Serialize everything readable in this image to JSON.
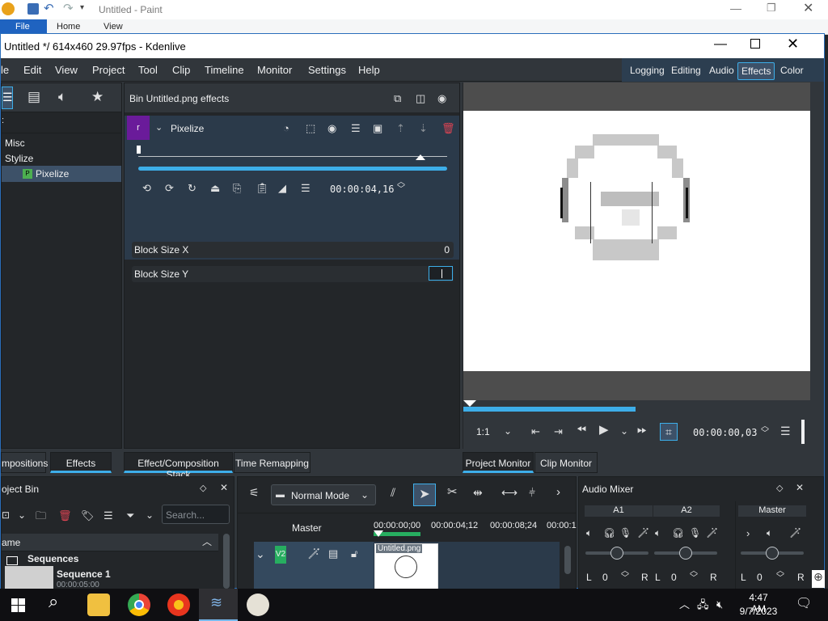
{
  "paint": {
    "title": "Untitled - Paint",
    "tabs": [
      "File",
      "Home",
      "View"
    ]
  },
  "window": {
    "title": "Untitled */ 614x460 29.97fps - Kdenlive"
  },
  "menu": [
    "le",
    "Edit",
    "View",
    "Project",
    "Tool",
    "Clip",
    "Timeline",
    "Monitor",
    "Settings",
    "Help"
  ],
  "layouts": {
    "items": [
      "Logging",
      "Editing",
      "Audio",
      "Effects",
      "Color"
    ],
    "active": "Effects"
  },
  "effects_tree": {
    "items": [
      "Misc",
      "Stylize",
      "Pixelize"
    ],
    "selected": "Pixelize",
    "badge": "P"
  },
  "effect_stack": {
    "title": "Bin Untitled.png effects",
    "effect_name": "Pixelize",
    "effect_badge": "r",
    "timecode": "00:00:04,16",
    "params": [
      {
        "label": "Block Size X",
        "value": "0"
      },
      {
        "label": "Block Size Y",
        "value": ""
      }
    ]
  },
  "monitor": {
    "zoom": "1:1",
    "timecode": "00:00:00,03"
  },
  "tabs_left": [
    "mpositions",
    "Effects"
  ],
  "tabs_mid": [
    "Effect/Composition Stack",
    "Time Remapping"
  ],
  "tabs_right": [
    "Project Monitor",
    "Clip Monitor"
  ],
  "project_bin": {
    "title": "oject Bin",
    "search_placeholder": "Search...",
    "column": "ame",
    "folder": "Sequences",
    "sequence_name": "Sequence 1",
    "sequence_duration": "00:00:05:00",
    "clip": "Untitled.png"
  },
  "timeline": {
    "mode": "Normal Mode",
    "master": "Master",
    "ruler": [
      "00:00:00;00",
      "00:00:04;12",
      "00:00:08;24",
      "00:00:1"
    ],
    "track": "V2",
    "clip": "Untitled.png"
  },
  "audio_mixer": {
    "title": "Audio Mixer",
    "channels": [
      "A1",
      "A2",
      "Master"
    ],
    "values": [
      "0",
      "0",
      "0"
    ],
    "left": "L",
    "right": "R"
  },
  "taskbar": {
    "time": "4:47 AM",
    "date": "9/7/2023"
  },
  "colors": {
    "accent": "#3daee9",
    "panel": "#232629",
    "window": "#31363b",
    "selection": "#3d5168"
  }
}
